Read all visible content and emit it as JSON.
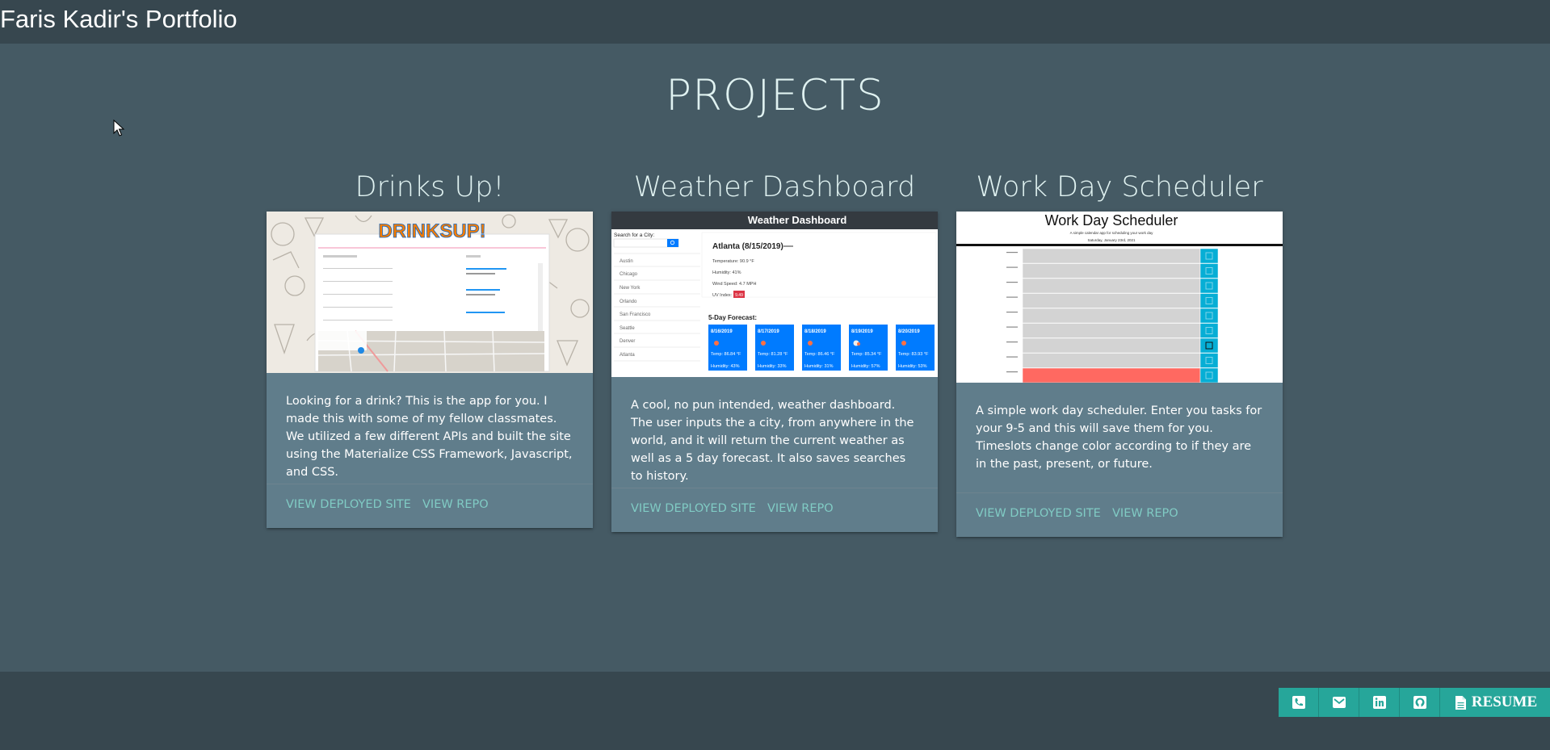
{
  "navbar": {
    "brand": "Faris Kadir's Portfolio"
  },
  "section": {
    "title": "PROJECTS"
  },
  "projects": [
    {
      "title": "Drinks Up!",
      "logo_text": "DRINKSUP!",
      "description": "Looking for a drink? This is the app for you. I made this with some of my fellow classmates. We utilized a few different APIs and built the site using the Materialize CSS Framework, Javascript, and CSS.",
      "deployed_label": "View Deployed Site",
      "repo_label": "View Repo"
    },
    {
      "title": "Weather Dashboard",
      "screenshot": {
        "header": "Weather Dashboard",
        "search_label": "Search for a City:",
        "cities": [
          "Austin",
          "Chicago",
          "New York",
          "Orlando",
          "San Francisco",
          "Seattle",
          "Denver",
          "Atlanta"
        ],
        "current_city": "Atlanta (8/15/2019)",
        "temperature": "Temperature: 90.9 °F",
        "humidity": "Humidity: 41%",
        "wind": "Wind Speed: 4.7 MPH",
        "uv_label": "UV Index:",
        "uv_value": "9.49",
        "forecast_label": "5-Day Forecast:",
        "forecast": [
          {
            "date": "8/16/2019",
            "temp": "Temp: 86.84 °F",
            "humidity": "Humidity: 43%"
          },
          {
            "date": "8/17/2019",
            "temp": "Temp: 81.28 °F",
            "humidity": "Humidity: 33%"
          },
          {
            "date": "8/18/2019",
            "temp": "Temp: 86.46 °F",
            "humidity": "Humidity: 31%"
          },
          {
            "date": "8/19/2019",
            "temp": "Temp: 85.34 °F",
            "humidity": "Humidity: 57%"
          },
          {
            "date": "8/20/2019",
            "temp": "Temp: 83.93 °F",
            "humidity": "Humidity: 53%"
          }
        ]
      },
      "description": "A cool, no pun intended, weather dashboard. The user inputs the a city, from anywhere in the world, and it will return the current weather as well as a 5 day forecast. It also saves searches to history.",
      "deployed_label": "View Deployed Site",
      "repo_label": "View Repo"
    },
    {
      "title": "Work Day Scheduler",
      "screenshot": {
        "header": "Work Day Scheduler",
        "subtitle": "A simple calendar app for scheduling your work day",
        "date": "Saturday, January 23rd, 2021"
      },
      "description": "A simple work day scheduler. Enter you tasks for your 9-5 and this will save them for you. Timeslots change color according to if they are in the past, present, or future.",
      "deployed_label": "View Deployed Site",
      "repo_label": "View Repo"
    }
  ],
  "footer": {
    "contact_icons": [
      "phone-icon",
      "email-icon",
      "linkedin-icon",
      "github-icon"
    ],
    "resume_label": "RESUME"
  },
  "colors": {
    "body_bg": "#455a64",
    "nav_bg": "#37474f",
    "card_bg": "#607d8b",
    "link": "#80cbc4",
    "teal": "#26a69a",
    "forecast_blue": "#007bff",
    "past_red": "#ff6961"
  }
}
